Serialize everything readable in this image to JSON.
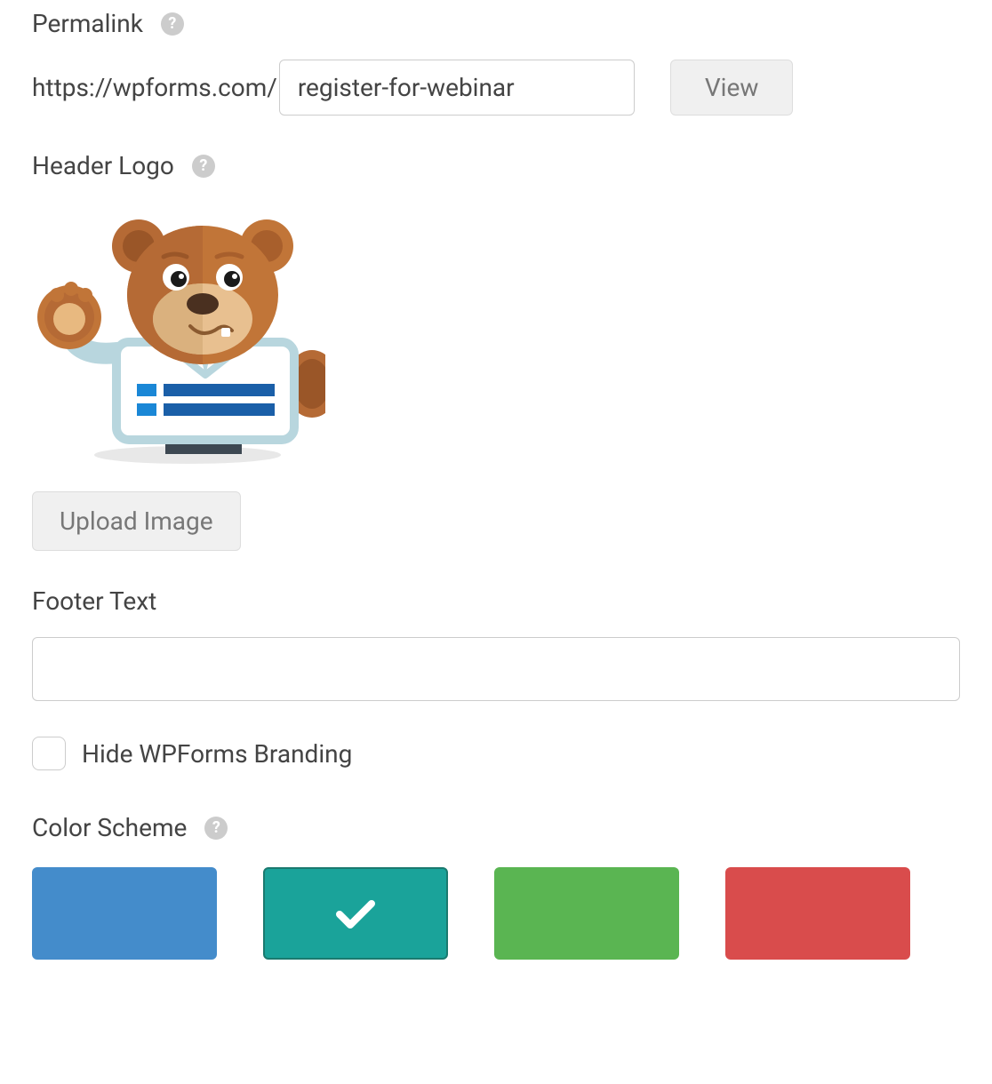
{
  "permalink": {
    "label": "Permalink",
    "base": "https://wpforms.com/",
    "slug": "register-for-webinar",
    "view_label": "View"
  },
  "headerLogo": {
    "label": "Header Logo",
    "upload_label": "Upload Image"
  },
  "footerText": {
    "label": "Footer Text",
    "value": ""
  },
  "hideBranding": {
    "label": "Hide WPForms Branding",
    "checked": false
  },
  "colorScheme": {
    "label": "Color Scheme",
    "swatches": [
      {
        "color": "#448ccb",
        "selected": false
      },
      {
        "color": "#1aa39a",
        "selected": true
      },
      {
        "color": "#5ab552",
        "selected": false
      },
      {
        "color": "#d94c4c",
        "selected": false
      }
    ]
  }
}
